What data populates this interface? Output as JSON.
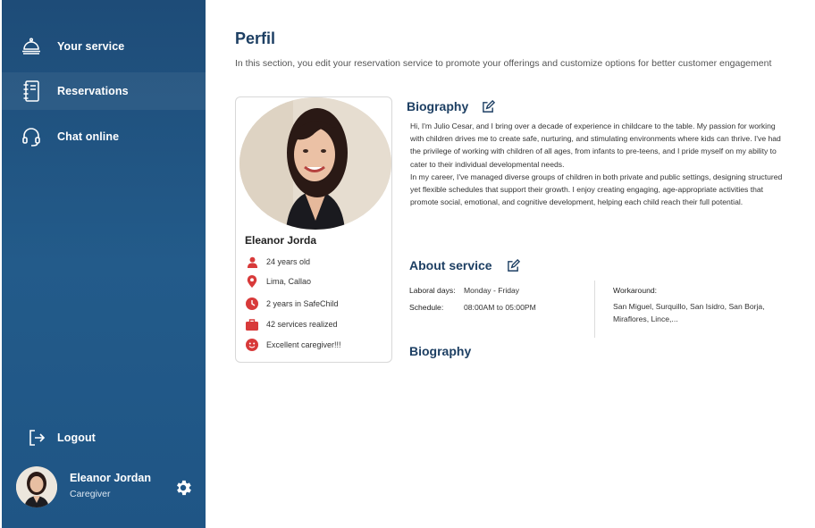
{
  "sidebar": {
    "items": [
      {
        "label": "Your service",
        "icon": "bell-service-icon"
      },
      {
        "label": "Reservations",
        "icon": "notebook-icon"
      },
      {
        "label": "Chat online",
        "icon": "headset-icon"
      }
    ],
    "logout_label": "Logout",
    "user": {
      "name": "Eleanor Jordan",
      "role": "Caregiver"
    }
  },
  "main": {
    "title": "Perfil",
    "subtitle": "In this section, you edit your reservation service to promote your offerings and customize options for better customer engagement",
    "profile": {
      "name": "Eleanor Jorda",
      "details": [
        {
          "icon": "person-icon",
          "text": "24 years old"
        },
        {
          "icon": "location-pin-icon",
          "text": "Lima, Callao"
        },
        {
          "icon": "clock-icon",
          "text": "2 years in SafeChild"
        },
        {
          "icon": "briefcase-icon",
          "text": "42 services realized"
        },
        {
          "icon": "smile-icon",
          "text": "Excellent caregiver!!!"
        }
      ]
    },
    "biography": {
      "title": "Biography",
      "paragraphs": [
        "Hi, I'm Julio Cesar, and I bring over a decade of experience in childcare to the table. My passion for working with children drives me to create safe, nurturing, and stimulating environments where kids can thrive. I've had the privilege of working with children of all ages, from infants to pre-teens, and I pride myself on my ability to cater to their individual developmental needs.",
        "In my career, I've managed diverse groups of children in both private and public settings, designing structured yet flexible schedules that support their growth. I enjoy creating engaging, age-appropriate activities that promote social, emotional, and cognitive development, helping each child reach their full potential."
      ]
    },
    "about_service": {
      "title": "About service",
      "laboral_days_label": "Laboral days:",
      "laboral_days_value": "Monday - Friday",
      "schedule_label": "Schedule:",
      "schedule_value": "08:00AM to 05:00PM",
      "workaround_label": "Workaround:",
      "workaround_value": "San Miguel, Surquillo, San Isidro, San Borja, Miraflores, Lince,..."
    },
    "biography2_title": "Biography"
  },
  "colors": {
    "sidebar": "#235b8a",
    "heading": "#1d3f63",
    "icon_red": "#d83a3a"
  }
}
